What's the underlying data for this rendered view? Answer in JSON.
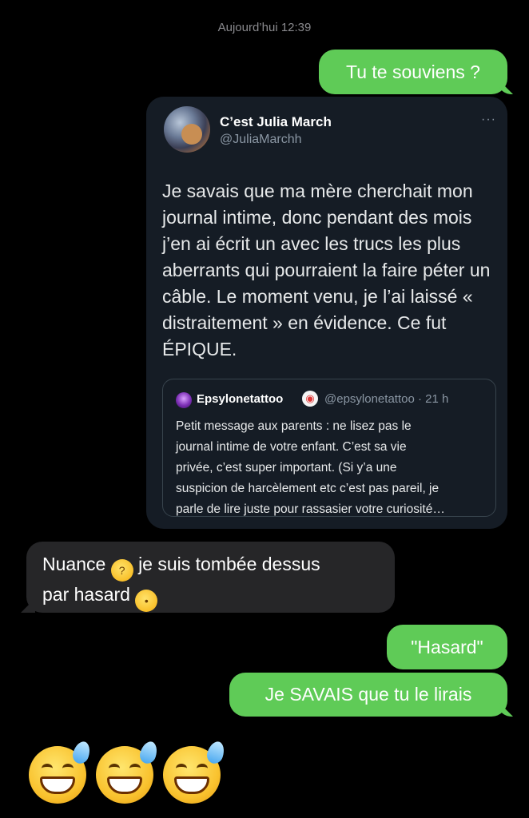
{
  "conversation": {
    "timestamp": "Aujourd’hui 12:39"
  },
  "messages": {
    "m1": "Tu te souviens ?",
    "m2_line1": "Nuance",
    "m2_line1b": "je suis tombée dessus",
    "m2_line2": "par hasard",
    "m3": "\"Hasard\"",
    "m4": "Je SAVAIS que tu le lirais"
  },
  "tweet": {
    "author_name": "C’est Julia March",
    "author_handle": "@JuliaMarchh",
    "more": "···",
    "text": "Je savais que ma mère cherchait mon journal intime, donc pendant des mois j’en ai écrit un avec les trucs les plus aberrants qui pourraient la faire péter un câble. Le moment venu, je l’ai laissé « distraitement » en évidence. Ce fut ÉPIQUE.",
    "quote": {
      "author_name": "Epsylonetattoo",
      "meta": "@epsylonetattoo · 21 h",
      "text": "Petit message aux parents : ne lisez pas le\njournal intime de votre enfant. C’est sa vie\nprivée, c’est super important. (Si y’a une\nsuspicion de harcèlement etc c’est pas pareil, je\nparle de lire juste pour rassasier votre curiosité…"
    }
  },
  "emojis": {
    "thinking": "thinking-face",
    "kissing": "kissing-face",
    "sweat_smile": "grinning-face-with-sweat"
  },
  "colors": {
    "sent_bubble": "#5fcb57",
    "received_bubble": "#262628",
    "background": "#000000",
    "tweet_card": "#151c25"
  }
}
